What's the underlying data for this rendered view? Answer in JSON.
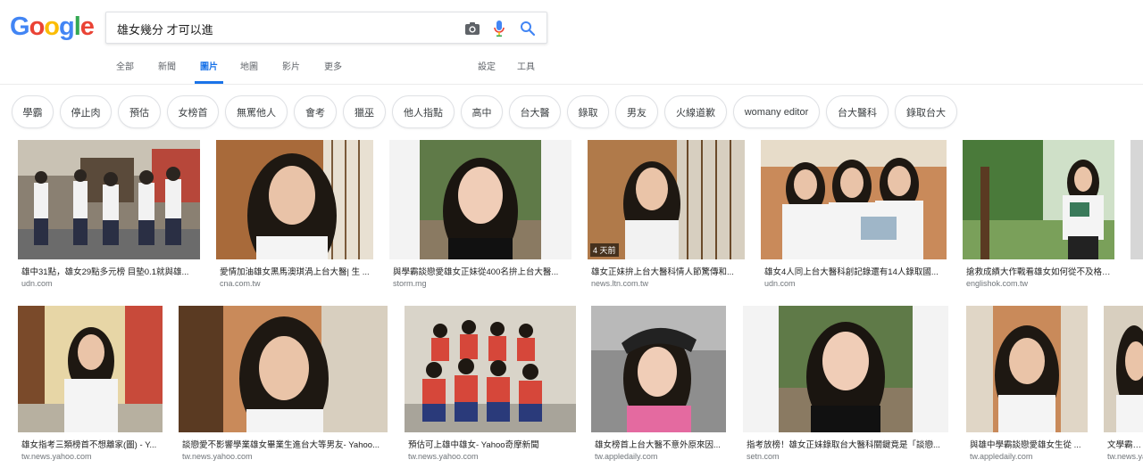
{
  "search": {
    "query": "雄女幾分 才可以進"
  },
  "logo": {
    "letters": [
      "G",
      "o",
      "o",
      "g",
      "l",
      "e"
    ],
    "colors": [
      "#4285f4",
      "#ea4335",
      "#fbbc05",
      "#4285f4",
      "#34a853",
      "#ea4335"
    ]
  },
  "nav": {
    "tabs": [
      {
        "label": "全部",
        "active": false
      },
      {
        "label": "新聞",
        "active": false
      },
      {
        "label": "圖片",
        "active": true
      },
      {
        "label": "地圖",
        "active": false
      },
      {
        "label": "影片",
        "active": false
      },
      {
        "label": "更多",
        "active": false
      }
    ],
    "settings": "設定",
    "tools": "工具"
  },
  "chips": [
    "學霸",
    "停止肉",
    "預估",
    "女榜首",
    "無罵他人",
    "會考",
    "獵巫",
    "他人指點",
    "高中",
    "台大醫",
    "錄取",
    "男友",
    "火線道歉",
    "womany editor",
    "台大醫科",
    "錄取台大"
  ],
  "images": [
    {
      "title": "雄中31點，雄女29點多元榜 目墊0.1就與雄...",
      "source": "udn.com",
      "badge": ""
    },
    {
      "title": "愛情加油雄女黑馬澳琪渦上台大醫| 生 ...",
      "source": "cna.com.tw",
      "badge": ""
    },
    {
      "title": "與學霸談戀愛雄女正妹從400名拚上台大醫...",
      "source": "storm.mg",
      "badge": ""
    },
    {
      "title": "雄女正妹拚上台大醫科情人節驚傳和...",
      "source": "news.ltn.com.tw",
      "badge": "4 天前"
    },
    {
      "title": "雄女4人同上台大醫科創記錄還有14人錄取國...",
      "source": "udn.com",
      "badge": ""
    },
    {
      "title": "搶救成績大作戰看雄女如何從不及格到學...",
      "source": "englishok.com.tw",
      "badge": ""
    },
    {
      "title": "雄女指考三類榜首不想離家(圖) - Y...",
      "source": "tw.news.yahoo.com",
      "badge": ""
    },
    {
      "title": "談戀愛不影響學業雄女畢業生進台大等男友- Yahoo...",
      "source": "tw.news.yahoo.com",
      "badge": ""
    },
    {
      "title": "預估可上雄中雄女- Yahoo奇摩新聞",
      "source": "tw.news.yahoo.com",
      "badge": ""
    },
    {
      "title": "雄女榜首上台大醫不意外原來因...",
      "source": "tw.appledaily.com",
      "badge": ""
    },
    {
      "title": "指考放榜！雄女正妹錄取台大醫科關鍵竟是「談戀...",
      "source": "setn.com",
      "badge": ""
    },
    {
      "title": "與雄中學霸談戀愛雄女生從 ...",
      "source": "tw.appledaily.com",
      "badge": ""
    },
    {
      "title": "文學霸男女...",
      "source": "tw.news.ya",
      "badge": ""
    }
  ]
}
